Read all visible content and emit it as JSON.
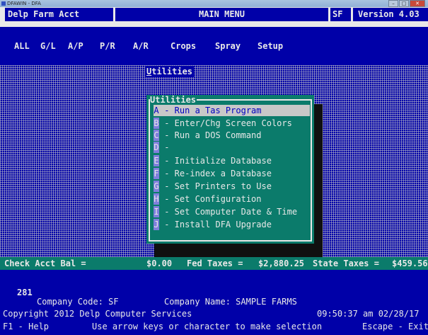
{
  "window": {
    "title": "DFAWIN - DFA",
    "minimize": "–",
    "maximize": "□",
    "close": "✕"
  },
  "status_bar": {
    "app_name": "Delp Farm Acct",
    "menu_name": "MAIN MENU",
    "user_initials": "SF",
    "version": "Version 4.03"
  },
  "top_menu": [
    "ALL",
    "G/L",
    "A/P",
    "P/R",
    "A/R",
    "Crops",
    "Spray",
    "Setup"
  ],
  "subtitle": {
    "hot": "U",
    "rest": "tilities"
  },
  "dialog": {
    "title": "Utilities",
    "options": [
      {
        "key": "A",
        "label": " - Run a Tas Program",
        "selected": true
      },
      {
        "key": "B",
        "label": " - Enter/Chg Screen Colors"
      },
      {
        "key": "C",
        "label": " - Run a DOS Command"
      },
      {
        "key": "D",
        "label": " -"
      },
      {
        "key": "E",
        "label": " - Initialize Database"
      },
      {
        "key": "F",
        "label": " - Re-index a Database"
      },
      {
        "key": "G",
        "label": " - Set Printers to Use"
      },
      {
        "key": "H",
        "label": " - Set Configuration"
      },
      {
        "key": "I",
        "label": " - Set Computer Date & Time"
      },
      {
        "key": "J",
        "label": " - Install DFA Upgrade"
      }
    ]
  },
  "info_row": {
    "check_label": "Check Acct Bal =",
    "check_value": "$0.00",
    "fed_label": "Fed Taxes =",
    "fed_value": "$2,880.25",
    "state_label": "State Taxes =",
    "state_value": "$459.56"
  },
  "footer": {
    "code_number": "281",
    "company_code": "Company Code: SF",
    "company_name": "Company Name: SAMPLE FARMS",
    "copyright": "Copyright 2012 Delp Computer Services",
    "datetime": "09:50:37 am 02/28/17",
    "help": "F1 - Help",
    "instructions": "Use arrow keys or character to make selection",
    "escape": "Escape - Exit"
  },
  "colors": {
    "screen_bg": "#0000a8",
    "dialog_bg": "#0b7b6b",
    "selected_bg": "#c8c8c8",
    "hotkey_bg": "#7f7fdc"
  }
}
